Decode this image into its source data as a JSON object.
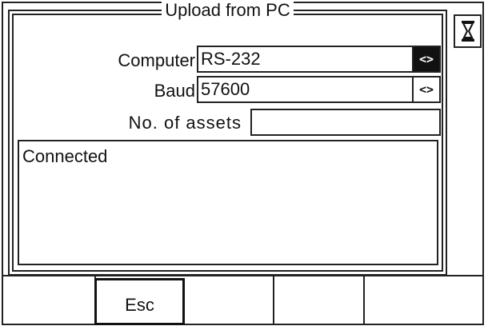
{
  "dialog": {
    "title": "Upload from PC",
    "fields": [
      {
        "label": "Computer",
        "value": "RS-232",
        "spin": "<>",
        "spin_active": true
      },
      {
        "label": "Baud",
        "value": "57600",
        "spin": "<>",
        "spin_active": false
      },
      {
        "label": "No. of assets",
        "value": ""
      }
    ],
    "status_text": "Connected"
  },
  "softkeys": [
    "",
    "Esc",
    "",
    "",
    ""
  ],
  "icons": {
    "busy": "hourglass-icon"
  }
}
